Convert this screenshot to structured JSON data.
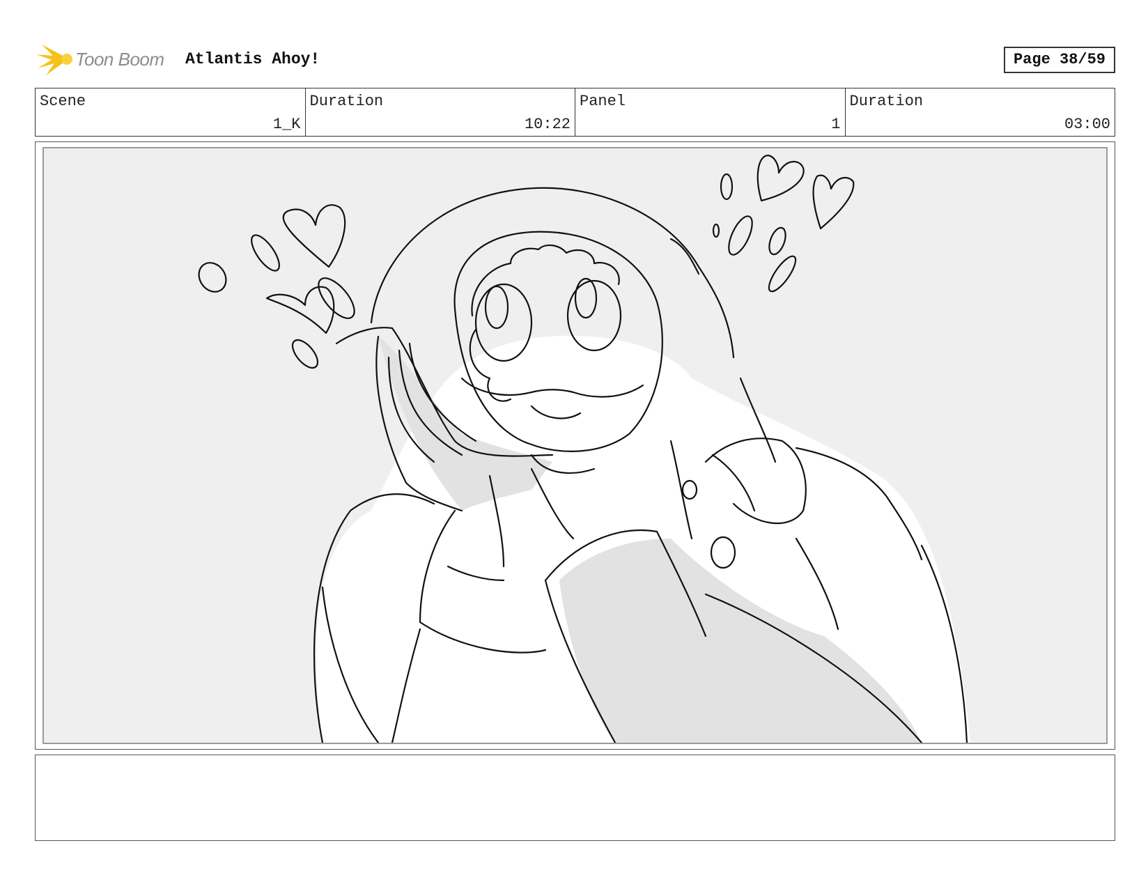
{
  "header": {
    "logo_text": "Toon Boom",
    "project_title": "Atlantis Ahoy!",
    "page_label": "Page 38/59"
  },
  "info": {
    "scene_label": "Scene",
    "scene_value": "1_K",
    "scene_duration_label": "Duration",
    "scene_duration_value": "10:22",
    "panel_label": "Panel",
    "panel_value": "1",
    "panel_duration_label": "Duration",
    "panel_duration_value": "03:00"
  },
  "panel": {
    "background_color": "#efefef",
    "shade_color": "#e2e2e2",
    "line_color": "#111111"
  },
  "notes": {
    "text": ""
  }
}
